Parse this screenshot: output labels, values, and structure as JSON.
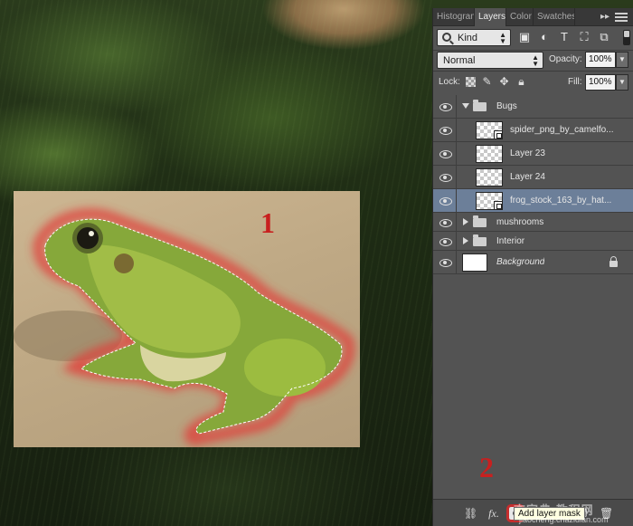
{
  "annotations": {
    "step1": "1",
    "step2": "2"
  },
  "panel": {
    "tabs": [
      "Histogram",
      "Layers",
      "Color",
      "Swatches"
    ],
    "active_tab": "Layers",
    "overflow_glyph": "▸▸",
    "filter": {
      "kind_label": "Kind"
    },
    "blend_mode": "Normal",
    "opacity_label": "Opacity:",
    "opacity_value": "100%",
    "lock_label": "Lock:",
    "fill_label": "Fill:",
    "fill_value": "100%",
    "layers": [
      {
        "name": "Bugs",
        "type": "group",
        "expanded": true
      },
      {
        "name": "spider_png_by_camelfo...",
        "type": "smart-object"
      },
      {
        "name": "Layer 23",
        "type": "pixel"
      },
      {
        "name": "Layer 24",
        "type": "pixel"
      },
      {
        "name": "frog_stock_163_by_hat...",
        "type": "smart-object",
        "selected": true
      },
      {
        "name": "mushrooms",
        "type": "group",
        "expanded": false
      },
      {
        "name": "Interior",
        "type": "group",
        "expanded": false
      },
      {
        "name": "Background",
        "type": "background",
        "locked": true
      }
    ],
    "tooltip": "Add layer mask",
    "selected_color": "#6c7f99",
    "annotation_color": "#c8201f"
  },
  "watermark": {
    "text": "查字典 教程网",
    "url": "jiaocheng.chazidian.com"
  }
}
